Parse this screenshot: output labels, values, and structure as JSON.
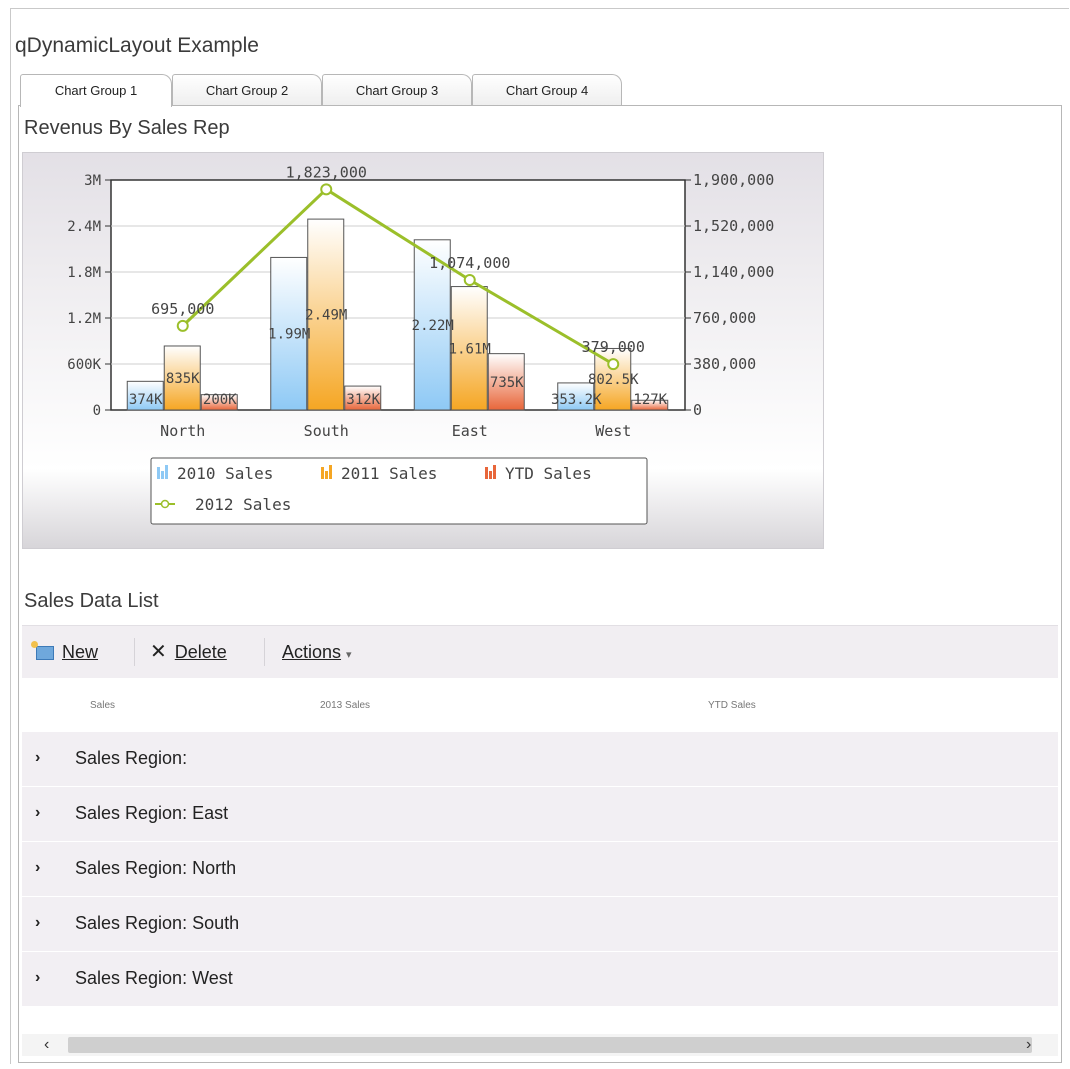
{
  "app": {
    "title": "qDynamicLayout Example"
  },
  "tabs": [
    {
      "label": "Chart Group 1"
    },
    {
      "label": "Chart Group 2"
    },
    {
      "label": "Chart Group 3"
    },
    {
      "label": "Chart Group 4"
    }
  ],
  "chart_section": {
    "title": "Revenus By Sales Rep"
  },
  "chart_data": {
    "type": "bar",
    "categories": [
      "North",
      "South",
      "East",
      "West"
    ],
    "series": [
      {
        "name": "2010 Sales",
        "type": "bar",
        "axis": "left",
        "values": [
          374000,
          1990000,
          2220000,
          353200
        ],
        "labels": [
          "374K",
          "1.99M",
          "2.22M",
          "353.2K"
        ],
        "color": "#8ec9f5"
      },
      {
        "name": "2011 Sales",
        "type": "bar",
        "axis": "left",
        "values": [
          835000,
          2490000,
          1610000,
          802500
        ],
        "labels": [
          "835K",
          "2.49M",
          "1.61M",
          "802.5K"
        ],
        "color": "#f5a623"
      },
      {
        "name": "YTD Sales",
        "type": "bar",
        "axis": "left",
        "values": [
          200000,
          312000,
          735000,
          127000
        ],
        "labels": [
          "200K",
          "312K",
          "735K",
          "127K"
        ],
        "color": "#e8663a"
      },
      {
        "name": "2012 Sales",
        "type": "line",
        "axis": "right",
        "values": [
          695000,
          1823000,
          1074000,
          379000
        ],
        "labels": [
          "695,000",
          "1,823,000",
          "1,074,000",
          "379,000"
        ],
        "color": "#9bbf2a"
      }
    ],
    "y_left": {
      "ylim": [
        0,
        3000000
      ],
      "ticks": [
        "0",
        "600K",
        "1.2M",
        "1.8M",
        "2.4M",
        "3M"
      ]
    },
    "y_right": {
      "ylim": [
        0,
        1900000
      ],
      "ticks": [
        "0",
        "380,000",
        "760,000",
        "1,140,000",
        "1,520,000",
        "1,900,000"
      ]
    },
    "grid": true,
    "legend_position": "bottom"
  },
  "list_section": {
    "title": "Sales Data List"
  },
  "toolbar": {
    "new_label": "New",
    "delete_label": "Delete",
    "actions_label": "Actions"
  },
  "columns": [
    "Sales",
    "2013 Sales",
    "YTD Sales"
  ],
  "rows": [
    {
      "label": "Sales Region:"
    },
    {
      "label": "Sales Region: East"
    },
    {
      "label": "Sales Region: North"
    },
    {
      "label": "Sales Region: South"
    },
    {
      "label": "Sales Region: West"
    }
  ]
}
